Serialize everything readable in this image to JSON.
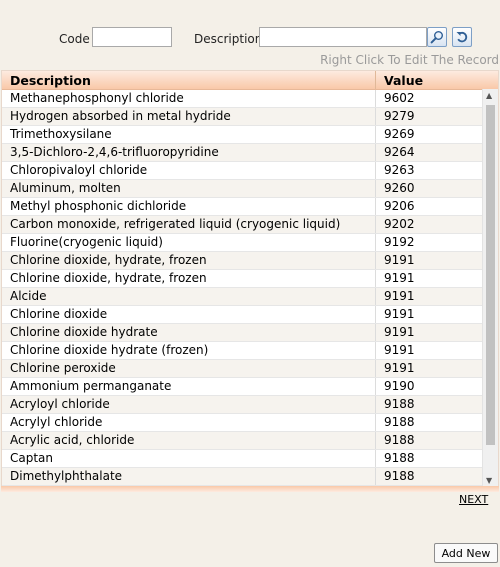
{
  "filters": {
    "code_label": "Code",
    "code_value": "",
    "description_label": "Description",
    "description_value": ""
  },
  "icons": {
    "search": "magnifier-icon",
    "reset": "refresh-icon"
  },
  "hint_text": "Right Click To Edit The Record",
  "grid": {
    "columns": [
      "Description",
      "Value"
    ],
    "rows": [
      [
        "Methanephosphonyl chloride",
        "9602"
      ],
      [
        "Hydrogen absorbed in metal hydride",
        "9279"
      ],
      [
        "Trimethoxysilane",
        "9269"
      ],
      [
        "3,5-Dichloro-2,4,6-trifluoropyridine",
        "9264"
      ],
      [
        "Chloropivaloyl chloride",
        "9263"
      ],
      [
        "Aluminum, molten",
        "9260"
      ],
      [
        "Methyl phosphonic dichloride",
        "9206"
      ],
      [
        "Carbon monoxide, refrigerated liquid (cryogenic liquid)",
        "9202"
      ],
      [
        "Fluorine(cryogenic liquid)",
        "9192"
      ],
      [
        "Chlorine dioxide, hydrate, frozen",
        "9191"
      ],
      [
        "Chlorine dioxide, hydrate, frozen",
        "9191"
      ],
      [
        "Alcide",
        "9191"
      ],
      [
        "Chlorine dioxide",
        "9191"
      ],
      [
        "Chlorine dioxide hydrate",
        "9191"
      ],
      [
        "Chlorine dioxide hydrate (frozen)",
        "9191"
      ],
      [
        "Chlorine peroxide",
        "9191"
      ],
      [
        "Ammonium permanganate",
        "9190"
      ],
      [
        "Acryloyl chloride",
        "9188"
      ],
      [
        "Acrylyl chloride",
        "9188"
      ],
      [
        "Acrylic acid, chloride",
        "9188"
      ],
      [
        "Captan",
        "9188"
      ],
      [
        "Dimethylphthalate",
        "9188"
      ]
    ]
  },
  "pager": {
    "next_label": "NEXT"
  },
  "actions": {
    "add_new_label": "Add New"
  },
  "colors": {
    "header_gradient_top": "#fdebe0",
    "header_gradient_bottom": "#f9c8a8",
    "page_bg": "#f4f0e8"
  }
}
